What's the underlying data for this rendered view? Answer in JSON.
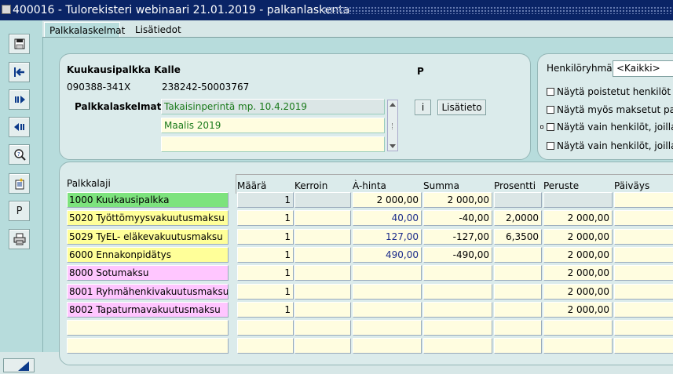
{
  "window": {
    "title": "400016 - Tulorekisteri webinaari 21.01.2019 - palkanlaskenta"
  },
  "toolbar": {
    "buttons": [
      {
        "name": "save-icon"
      },
      {
        "name": "exit-icon"
      },
      {
        "name": "next-record-icon"
      },
      {
        "name": "previous-record-icon"
      },
      {
        "name": "search-icon"
      },
      {
        "name": "new-record-icon"
      },
      {
        "name": "p-icon",
        "label": "P"
      },
      {
        "name": "print-icon"
      }
    ]
  },
  "tabs": [
    {
      "label": "Palkkalaskelmat",
      "active": true
    },
    {
      "label": "Lisätiedot",
      "active": false
    }
  ],
  "employee": {
    "name": "Kuukausipalkka Kalle",
    "flag": "P",
    "ssn": "090388-341X",
    "account": "238242-50003767",
    "calc_label": "Palkkalaskelmat",
    "calc_rows": [
      "Takaisinperintä mp. 10.4.2019",
      "Maalis 2019",
      ""
    ],
    "info_button": "i",
    "more_button": "Lisätieto"
  },
  "filter": {
    "group_label": "Henkilöryhmä",
    "group_value": "<Kaikki>",
    "options": [
      "Näytä poistetut henkilöt",
      "Näytä myös maksetut pal",
      "Näytä vain henkilöt, joilla",
      "Näytä vain henkilöt, joilla"
    ]
  },
  "table": {
    "section_label": "Palkkalaji",
    "columns": [
      "Määrä",
      "Kerroin",
      "À-hinta",
      "Summa",
      "Prosentti",
      "Peruste",
      "Päiväys"
    ],
    "rows": [
      {
        "label": "1000 Kuukausipalkka",
        "color": "#7de37d",
        "maara": "1",
        "kerroin": "",
        "ahinta": "2 000,00",
        "summa": "2 000,00",
        "prosentti": "",
        "peruste": "",
        "paivays": ""
      },
      {
        "label": "5020 Työttömyysvakuutusmaksu",
        "color": "#ffff99",
        "maara": "1",
        "kerroin": "",
        "ahinta": "40,00",
        "summa": "-40,00",
        "prosentti": "2,0000",
        "peruste": "2 000,00",
        "paivays": ""
      },
      {
        "label": "5029 TyEL- eläkevakuutusmaksu",
        "color": "#ffff99",
        "maara": "1",
        "kerroin": "",
        "ahinta": "127,00",
        "summa": "-127,00",
        "prosentti": "6,3500",
        "peruste": "2 000,00",
        "paivays": ""
      },
      {
        "label": "6000 Ennakonpidätys",
        "color": "#ffff99",
        "maara": "1",
        "kerroin": "",
        "ahinta": "490,00",
        "summa": "-490,00",
        "prosentti": "",
        "peruste": "2 000,00",
        "paivays": ""
      },
      {
        "label": "8000 Sotumaksu",
        "color": "#ffc6ff",
        "maara": "1",
        "kerroin": "",
        "ahinta": "",
        "summa": "",
        "prosentti": "",
        "peruste": "2 000,00",
        "paivays": ""
      },
      {
        "label": "8001 Ryhmähenkivakuutusmaksu",
        "color": "#ffc6ff",
        "maara": "1",
        "kerroin": "",
        "ahinta": "",
        "summa": "",
        "prosentti": "",
        "peruste": "2 000,00",
        "paivays": ""
      },
      {
        "label": "8002 Tapaturmavakuutusmaksu",
        "color": "#ffc6ff",
        "maara": "1",
        "kerroin": "",
        "ahinta": "",
        "summa": "",
        "prosentti": "",
        "peruste": "2 000,00",
        "paivays": ""
      },
      {
        "label": "",
        "color": "#fffde0",
        "maara": "",
        "kerroin": "",
        "ahinta": "",
        "summa": "",
        "prosentti": "",
        "peruste": "",
        "paivays": ""
      },
      {
        "label": "",
        "color": "#fffde0",
        "maara": "",
        "kerroin": "",
        "ahinta": "",
        "summa": "",
        "prosentti": "",
        "peruste": "",
        "paivays": ""
      }
    ]
  }
}
